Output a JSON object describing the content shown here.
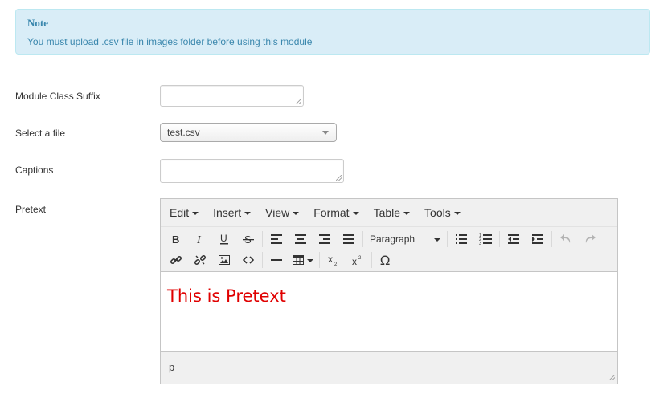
{
  "note": {
    "title": "Note",
    "text": "You must upload .csv file in images folder before using this module"
  },
  "form": {
    "module_class_suffix_label": "Module Class Suffix",
    "module_class_suffix_value": "",
    "select_file_label": "Select a file",
    "select_file_value": "test.csv",
    "captions_label": "Captions",
    "captions_value": "",
    "pretext_label": "Pretext"
  },
  "editor": {
    "menus": [
      "Edit",
      "Insert",
      "View",
      "Format",
      "Table",
      "Tools"
    ],
    "format_select": "Paragraph",
    "content_text": "This is Pretext",
    "content_color": "#e00000",
    "status_path": "p",
    "toolbar_icons": [
      "bold-icon",
      "italic-icon",
      "underline-icon",
      "strikethrough-icon",
      "align-left-icon",
      "align-center-icon",
      "align-right-icon",
      "align-justify-icon",
      "bullet-list-icon",
      "numbered-list-icon",
      "outdent-icon",
      "indent-icon",
      "undo-icon",
      "redo-icon",
      "link-icon",
      "unlink-icon",
      "image-icon",
      "code-icon",
      "horizontal-rule-icon",
      "table-icon",
      "subscript-icon",
      "superscript-icon",
      "special-character-icon"
    ]
  },
  "colors": {
    "note_bg": "#d9edf7",
    "note_text": "#3a87ad",
    "editor_bg": "#f0f0f0"
  }
}
